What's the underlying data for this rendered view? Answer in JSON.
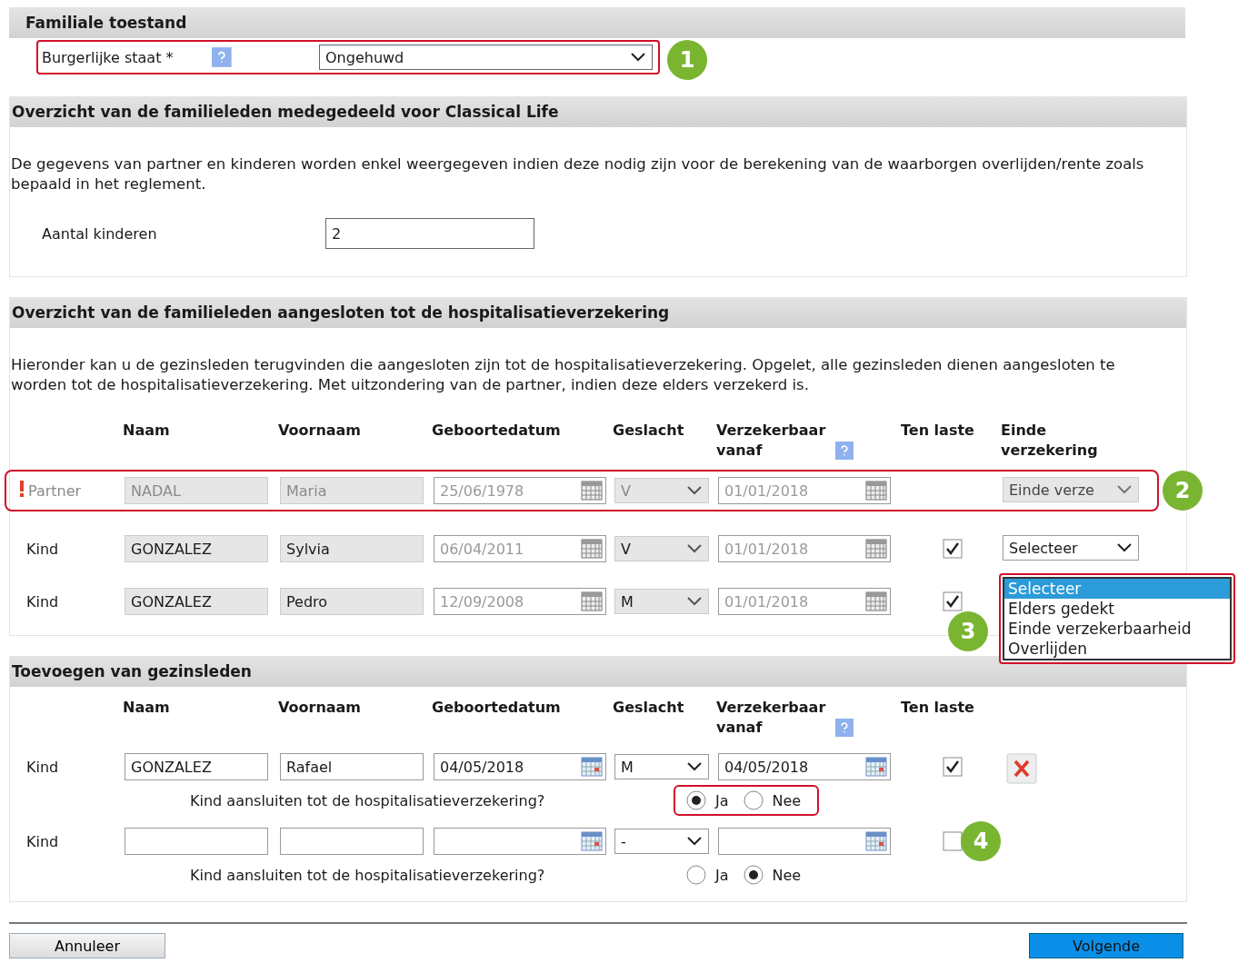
{
  "familiale": {
    "title": "Familiale toestand",
    "field": {
      "label": "Burgerlijke staat *",
      "help": true,
      "value": "Ongehuwd",
      "highlight": true,
      "callout": "1"
    }
  },
  "overzicht": {
    "title": "Overzicht van de familieleden medegedeeld voor Classical Life",
    "text": "De gegevens van partner en kinderen worden enkel weergegeven indien deze nodig zijn voor de berekening van de waarborgen overlijden/rente zoals bepaald in het reglement.",
    "count_label": "Aantal kinderen",
    "count_value": "2"
  },
  "hospitalisatie": {
    "title": "Overzicht van de familieleden aangesloten tot de hospitalisatieverzekering",
    "text": "Hieronder kan u de gezinsleden terugvinden die aangesloten zijn tot de hospitalisatieverzekering. Opgelet, alle gezinsleden dienen aangesloten te worden tot de hospitalisatieverzekering. Met uitzondering van de partner, indien deze elders verzekerd is.",
    "columns": [
      {
        "label": "Naam",
        "help": false
      },
      {
        "label": "Voornaam",
        "help": false
      },
      {
        "label": "Geboortedatum",
        "help": false
      },
      {
        "label": "Geslacht",
        "help": false
      },
      {
        "label": "Verzekerbaar vanaf",
        "help": true
      },
      {
        "label": "Ten laste",
        "help": false
      },
      {
        "label": "Einde verzekering",
        "help": false
      }
    ],
    "rows": [
      {
        "relation": "Partner",
        "warning": true,
        "inactive": true,
        "highlight": true,
        "callout": "2",
        "naam": "NADAL",
        "voornaam": "Maria",
        "geboortedatum": "25/06/1978",
        "geslacht": "V",
        "vanaf": "01/01/2018",
        "einde": {
          "kind": "select",
          "value": "Einde verze",
          "disabled": true
        }
      },
      {
        "relation": "Kind",
        "warning": false,
        "inactive": false,
        "highlight": false,
        "naam": "GONZALEZ",
        "voornaam": "Sylvia",
        "geboortedatum": "06/04/2011",
        "geslacht": "V",
        "vanaf": "01/01/2018",
        "ten_laste": true,
        "einde": {
          "kind": "select",
          "value": "Selecteer",
          "disabled": false
        }
      },
      {
        "relation": "Kind",
        "warning": false,
        "inactive": false,
        "highlight": false,
        "naam": "GONZALEZ",
        "voornaam": "Pedro",
        "geboortedatum": "12/09/2008",
        "geslacht": "M",
        "vanaf": "01/01/2018",
        "ten_laste": true,
        "einde": {
          "kind": "listbox",
          "highlight": true,
          "callout": "3",
          "options": [
            {
              "label": "Selecteer",
              "selected": true
            },
            {
              "label": "Elders gedekt",
              "selected": false
            },
            {
              "label": "Einde verzekerbaarheid",
              "selected": false
            },
            {
              "label": "Overlijden",
              "selected": false
            }
          ]
        }
      }
    ]
  },
  "toevoegen": {
    "title": "Toevoegen van gezinsleden",
    "columns": [
      {
        "label": "Naam",
        "help": false
      },
      {
        "label": "Voornaam",
        "help": false
      },
      {
        "label": "Geboortedatum",
        "help": false
      },
      {
        "label": "Geslacht",
        "help": false
      },
      {
        "label": "Verzekerbaar vanaf",
        "help": true
      },
      {
        "label": "Ten laste",
        "help": false
      }
    ],
    "rows": [
      {
        "relation": "Kind",
        "naam": "GONZALEZ",
        "voornaam": "Rafael",
        "geboortedatum": "04/05/2018",
        "geslacht": "M",
        "vanaf": "04/05/2018",
        "ten_laste": true,
        "deletable": true,
        "question": "Kind aansluiten tot de hospitalisatieverzekering?",
        "options_highlight": true,
        "options": [
          {
            "label": "Ja",
            "selected": true
          },
          {
            "label": "Nee",
            "selected": false
          }
        ]
      },
      {
        "relation": "Kind",
        "geslacht": "-",
        "ten_laste": false,
        "ten_laste_callout": "4",
        "deletable": false,
        "question": "Kind aansluiten tot de hospitalisatieverzekering?",
        "options_highlight": false,
        "options": [
          {
            "label": "Ja",
            "selected": false
          },
          {
            "label": "Nee",
            "selected": true
          }
        ]
      }
    ]
  },
  "buttons": [
    {
      "label": "Annuleer",
      "kind": "secondary"
    },
    {
      "label": "Volgende",
      "kind": "primary"
    }
  ]
}
